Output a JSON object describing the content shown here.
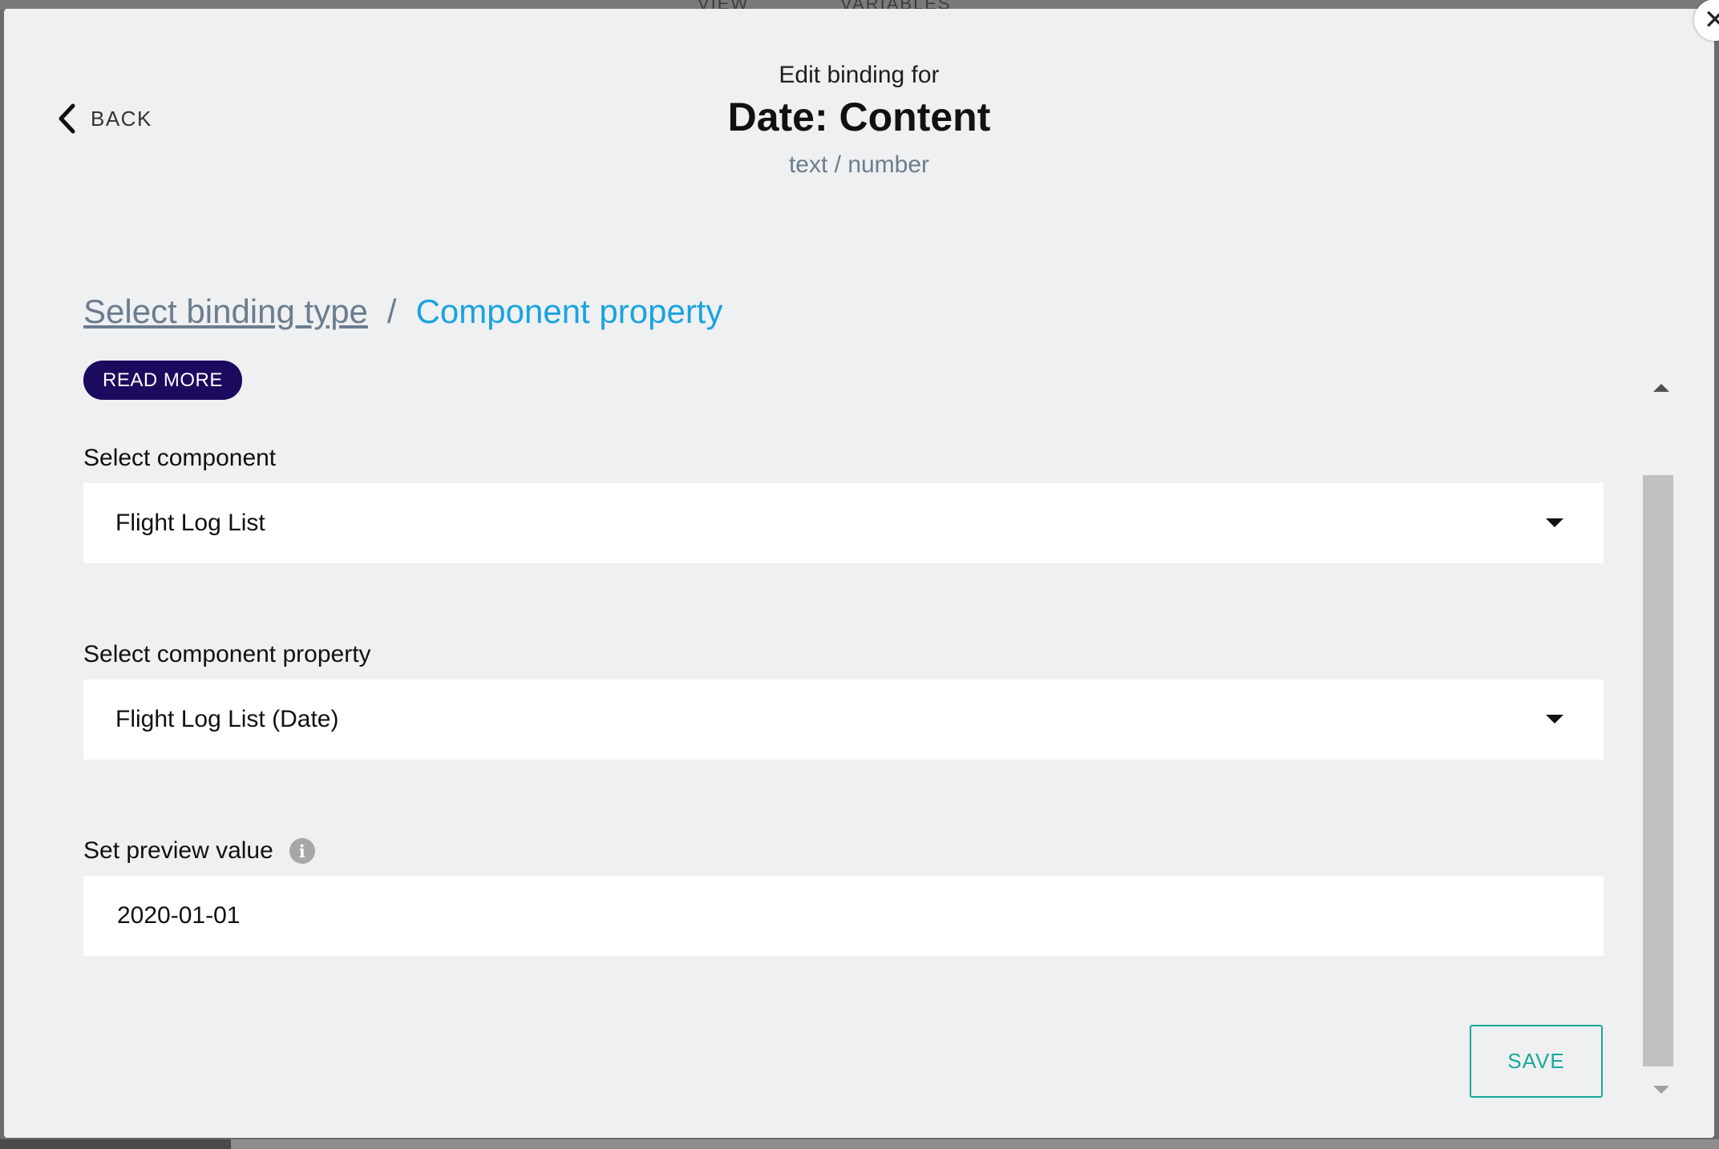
{
  "backdrop": {
    "tab_view": "VIEW",
    "tab_variables": "VARIABLES"
  },
  "modal": {
    "close_symbol": "✕",
    "back_label": "BACK",
    "subheading": "Edit binding for",
    "title": "Date: Content",
    "types": "text / number"
  },
  "breadcrumb": {
    "link": "Select binding type",
    "separator": "/",
    "current": "Component property"
  },
  "read_more_label": "READ MORE",
  "form": {
    "component_label": "Select component",
    "component_value": "Flight Log List",
    "property_label": "Select component property",
    "property_value": "Flight Log List (Date)",
    "preview_label": "Set preview value",
    "preview_value": "2020-01-01",
    "info_symbol": "i"
  },
  "save_label": "SAVE",
  "colors": {
    "accent_link": "#1aa3e0",
    "read_more_bg": "#1c0a5e",
    "save_accent": "#17a99a",
    "modal_bg": "#eff0f1"
  }
}
